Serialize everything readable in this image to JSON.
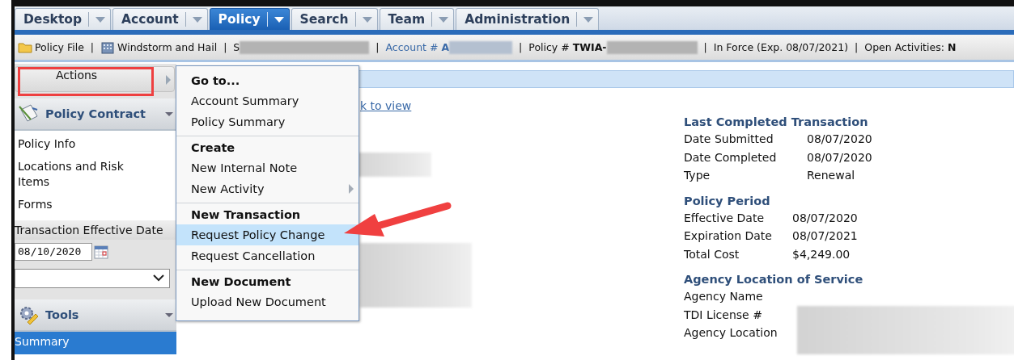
{
  "tabs": [
    {
      "label": "Desktop",
      "selected": false
    },
    {
      "label": "Account",
      "selected": false
    },
    {
      "label": "Policy",
      "selected": true
    },
    {
      "label": "Search",
      "selected": false
    },
    {
      "label": "Team",
      "selected": false
    },
    {
      "label": "Administration",
      "selected": false
    }
  ],
  "info_bar": {
    "separator": "|",
    "items": [
      {
        "kind": "folder",
        "text": "Policy File"
      },
      {
        "kind": "building",
        "text": "Windstorm and Hail"
      },
      {
        "kind": "redacted",
        "text": "S"
      },
      {
        "kind": "account",
        "text": "Account # **A**"
      },
      {
        "kind": "policy",
        "text": "Policy # **TWIA-**"
      },
      {
        "kind": "plain",
        "text": "In Force (Exp. 08/07/2021)"
      },
      {
        "kind": "plain",
        "text": "Open Activities:  **N**"
      }
    ]
  },
  "sidebar": {
    "actions_button": "Actions",
    "sections": [
      {
        "title": "Policy Contract",
        "kind": "contract",
        "items": [
          {
            "label": "Policy Info",
            "selected": false
          },
          {
            "label": "Locations and Risk Items",
            "selected": false
          },
          {
            "label": "Forms",
            "selected": false
          }
        ]
      }
    ],
    "effective_date_label": "Transaction Effective Date",
    "effective_date_value": "08/10/2020",
    "tools": {
      "title": "Tools",
      "items": [
        {
          "label": "Summary",
          "selected": true
        }
      ]
    }
  },
  "actions_menu": {
    "groups": [
      {
        "heading": "Go to...",
        "items": [
          {
            "label": "Account Summary",
            "selected": false,
            "submenu": false
          },
          {
            "label": "Policy Summary",
            "selected": false,
            "submenu": false
          }
        ]
      },
      {
        "heading": "Create",
        "items": [
          {
            "label": "New Internal Note",
            "selected": false,
            "submenu": false
          },
          {
            "label": "New Activity",
            "selected": false,
            "submenu": true
          }
        ]
      },
      {
        "heading": "New Transaction",
        "items": [
          {
            "label": "Request Policy Change",
            "selected": true,
            "submenu": false
          },
          {
            "label": "Request Cancellation",
            "selected": false,
            "submenu": false
          }
        ]
      },
      {
        "heading": "New Document",
        "items": [
          {
            "label": "Upload New Document",
            "selected": false,
            "submenu": false
          }
        ]
      }
    ]
  },
  "main": {
    "link": "k to view"
  },
  "summary": {
    "sections": [
      {
        "heading": "Last Completed Transaction",
        "rows": [
          {
            "label": "Date Submitted",
            "value": "08/07/2020"
          },
          {
            "label": "Date Completed",
            "value": "08/07/2020"
          },
          {
            "label": "Type",
            "value": "Renewal"
          }
        ]
      },
      {
        "heading": "Policy Period",
        "rows": [
          {
            "label": "Effective Date",
            "value": "08/07/2020"
          },
          {
            "label": "Expiration Date",
            "value": "08/07/2021"
          },
          {
            "label": "Total Cost",
            "value": "$4,249.00"
          }
        ]
      },
      {
        "heading": "Agency Location of Service",
        "rows": [
          {
            "label": "Agency Name"
          },
          {
            "label": "TDI License #"
          },
          {
            "label": "Agency Location"
          }
        ]
      }
    ]
  }
}
